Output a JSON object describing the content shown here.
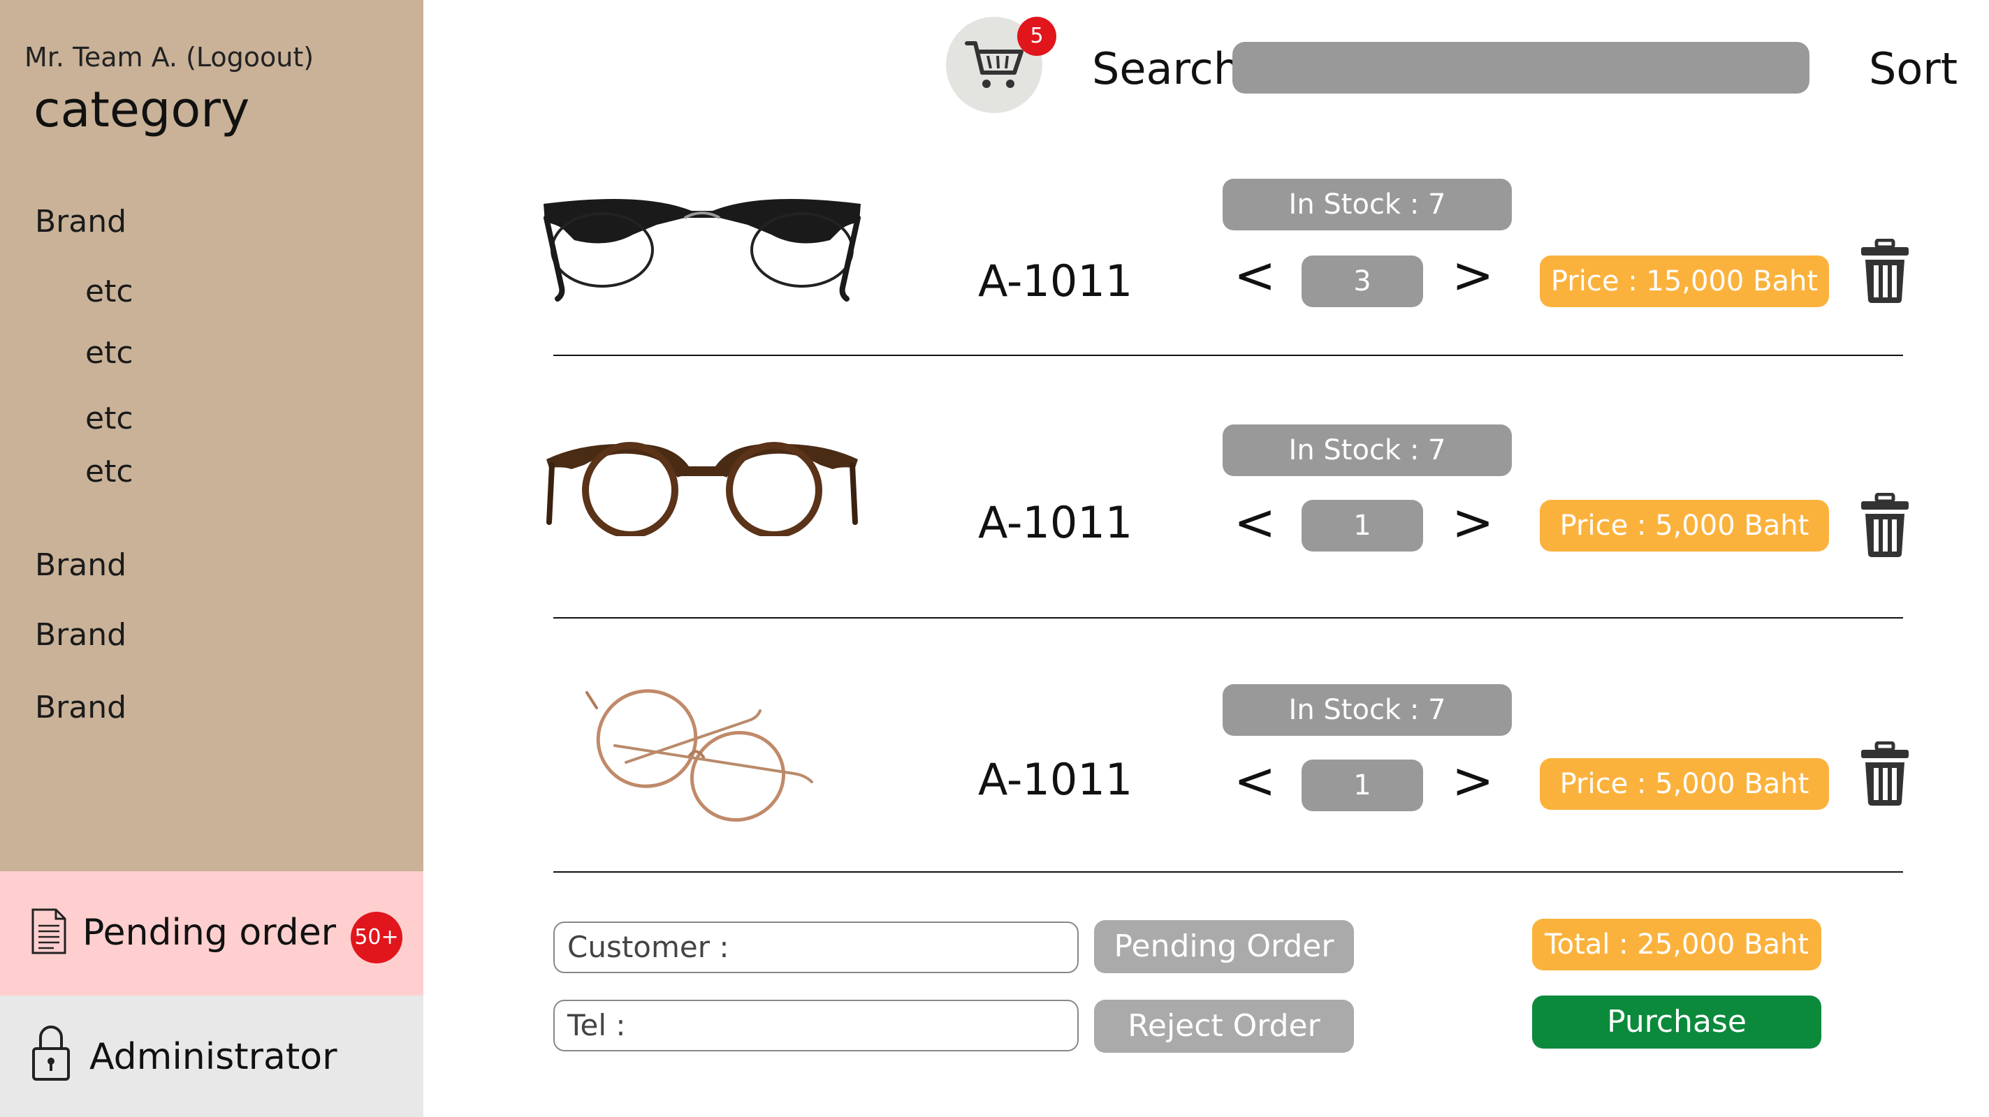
{
  "sidebar": {
    "user_text": "Mr. Team A. (Logoout)",
    "category_title": "category",
    "links": [
      "Brand",
      "etc",
      "etc",
      "etc",
      "etc",
      "Brand",
      "Brand",
      "Brand"
    ],
    "pending": {
      "label": "Pending order",
      "badge": "50+",
      "icon": "document-icon"
    },
    "admin": {
      "label": "Administrator",
      "icon": "lock-icon"
    }
  },
  "header": {
    "cart_count": "5",
    "search_label": "Search",
    "search_value": "",
    "sort_label": "Sort"
  },
  "cart": {
    "items": [
      {
        "code": "A-1011",
        "stock": "In Stock : 7",
        "qty": "3",
        "price": "Price : 15,000 Baht",
        "frame": "black browline"
      },
      {
        "code": "A-1011",
        "stock": "In Stock : 7",
        "qty": "1",
        "price": "Price : 5,000 Baht",
        "frame": "tortoiseshell round"
      },
      {
        "code": "A-1011",
        "stock": "In Stock : 7",
        "qty": "1",
        "price": "Price : 5,000 Baht",
        "frame": "rose gold wire round"
      }
    ],
    "prev_symbol": "<",
    "next_symbol": ">"
  },
  "form": {
    "customer_label": "Customer :",
    "tel_label": "Tel :",
    "pending_button": "Pending Order",
    "reject_button": "Reject Order",
    "total": "Total : 25,000 Baht",
    "purchase_button": "Purchase"
  },
  "colors": {
    "sidebar_bg": "#c9b298",
    "pending_bg": "#ffcfcf",
    "admin_bg": "#e8e8e8",
    "badge_red": "#e0161c",
    "pill_gray": "#999999",
    "price_orange": "#fbb23d",
    "purchase_green": "#0c8a3c"
  }
}
